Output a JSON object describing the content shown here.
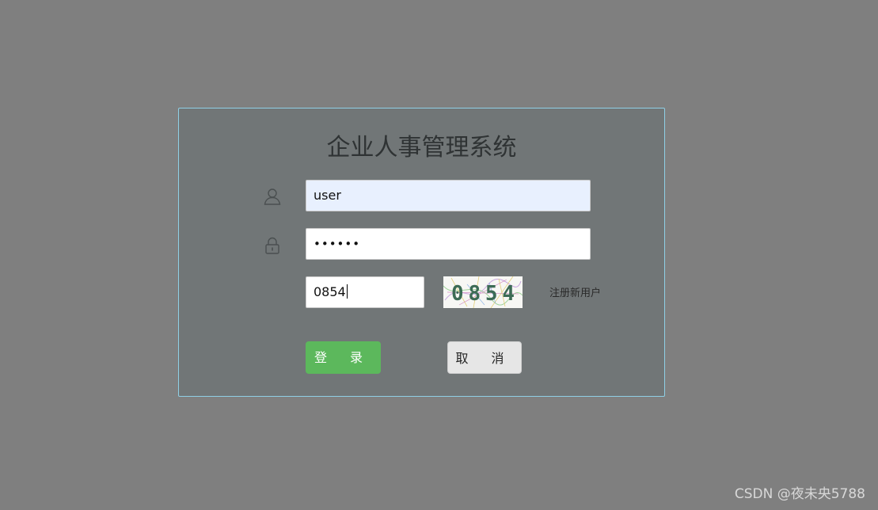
{
  "form": {
    "title": "企业人事管理系统",
    "username": {
      "value": "user",
      "icon": "user-icon"
    },
    "password": {
      "masked_value": "••••••",
      "icon": "lock-icon"
    },
    "captcha": {
      "input_value": "0854",
      "image_text": "0854"
    },
    "register_link": "注册新用户",
    "login_button": "登 录",
    "cancel_button": "取 消"
  },
  "watermark": "CSDN @夜未央5788",
  "colors": {
    "background": "#7f7f7f",
    "panel": "#717677",
    "panel_border": "#8fd0e6",
    "login_button": "#5cb85c",
    "cancel_button": "#e6e6e6"
  }
}
